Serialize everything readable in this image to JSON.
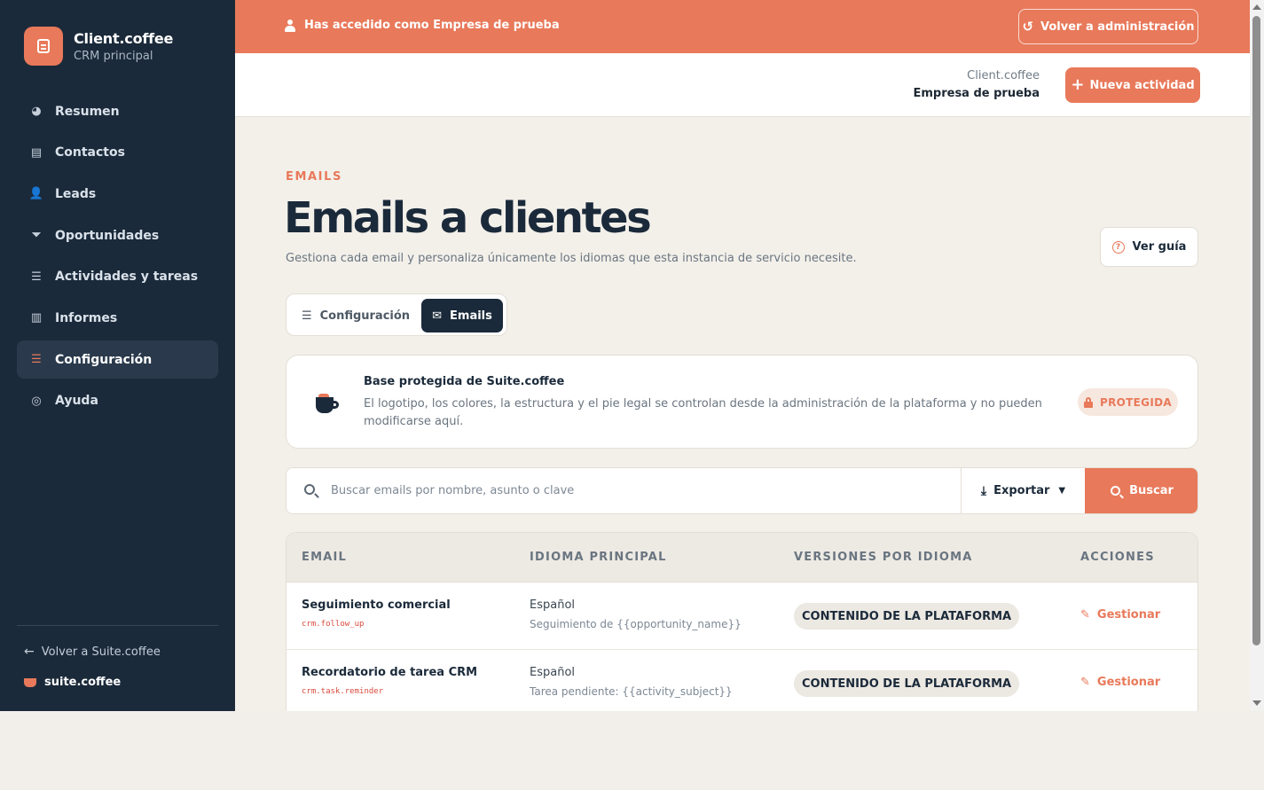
{
  "colors": {
    "accent": "#e8795a",
    "sidebar_bg": "#1b2a3a",
    "page_bg": "#f3f0ea"
  },
  "sidebar": {
    "brand_name": "Client.coffee",
    "brand_subtitle": "CRM principal",
    "items": [
      {
        "label": "Resumen",
        "icon": "pie-chart-icon",
        "active": false
      },
      {
        "label": "Contactos",
        "icon": "address-card-icon",
        "active": false
      },
      {
        "label": "Leads",
        "icon": "user-plus-icon",
        "active": false
      },
      {
        "label": "Oportunidades",
        "icon": "funnel-icon",
        "active": false
      },
      {
        "label": "Actividades y tareas",
        "icon": "list-icon",
        "active": false
      },
      {
        "label": "Informes",
        "icon": "bar-chart-icon",
        "active": false
      },
      {
        "label": "Configuración",
        "icon": "sliders-icon",
        "active": true
      },
      {
        "label": "Ayuda",
        "icon": "lifebuoy-icon",
        "active": false
      }
    ],
    "back_link": "Volver a Suite.coffee",
    "suite_brand": "suite.coffee"
  },
  "banner": {
    "text": "Has accedido como Empresa de prueba",
    "back_button": "Volver a administración"
  },
  "topbar": {
    "tenant_app": "Client.coffee",
    "tenant_company": "Empresa de prueba",
    "new_activity": "Nueva actividad"
  },
  "main": {
    "eyebrow": "EMAILS",
    "title": "Emails a clientes",
    "description": "Gestiona cada email y personaliza únicamente los idiomas que esta instancia de servicio necesite.",
    "guide_button": "Ver guía",
    "tabs": [
      {
        "label": "Configuración",
        "active": false
      },
      {
        "label": "Emails",
        "active": true
      }
    ],
    "notice": {
      "title": "Base protegida de Suite.coffee",
      "description": "El logotipo, los colores, la estructura y el pie legal se controlan desde la administración de la plataforma y no pueden modificarse aquí.",
      "badge": "PROTEGIDA"
    },
    "search": {
      "placeholder": "Buscar emails por nombre, asunto o clave",
      "value": "",
      "export_label": "Exportar",
      "search_label": "Buscar"
    },
    "table": {
      "columns": [
        "EMAIL",
        "IDIOMA PRINCIPAL",
        "VERSIONES POR IDIOMA",
        "ACCIONES"
      ],
      "rows": [
        {
          "name": "Seguimiento comercial",
          "key": "crm.follow_up",
          "language": "Español",
          "subject": "Seguimiento de {{opportunity_name}}",
          "versions": "CONTENIDO DE LA PLATAFORMA",
          "action": "Gestionar"
        },
        {
          "name": "Recordatorio de tarea CRM",
          "key": "crm.task.reminder",
          "language": "Español",
          "subject": "Tarea pendiente: {{activity_subject}}",
          "versions": "CONTENIDO DE LA PLATAFORMA",
          "action": "Gestionar"
        }
      ]
    }
  }
}
